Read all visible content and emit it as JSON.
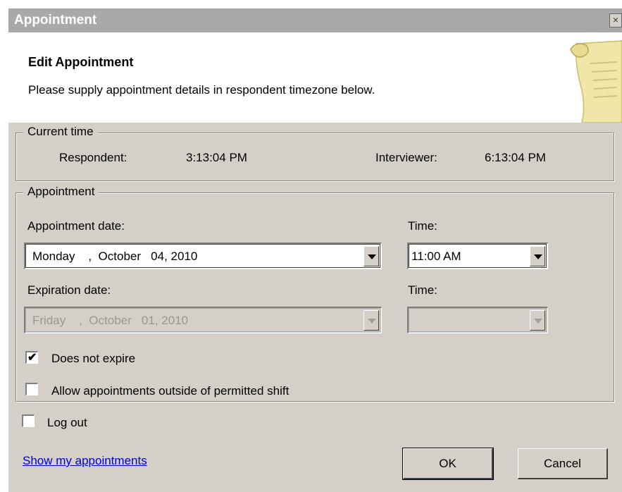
{
  "window": {
    "title": "Appointment",
    "close_glyph": "×"
  },
  "header": {
    "heading": "Edit Appointment",
    "subtitle": "Please supply appointment details in respondent timezone below.",
    "icon": "scroll-icon"
  },
  "current_time": {
    "legend": "Current time",
    "respondent_label": "Respondent:",
    "respondent_value": "3:13:04 PM",
    "interviewer_label": "Interviewer:",
    "interviewer_value": "6:13:04 PM"
  },
  "appointment": {
    "legend": "Appointment",
    "date_label": "Appointment date:",
    "date_value": "Monday    ,  October   04, 2010",
    "time_label": "Time:",
    "time_value": "11:00 AM",
    "expiration_label": "Expiration date:",
    "expiration_value": "Friday    ,  October   01, 2010",
    "expiration_time_label": "Time:",
    "expiration_time_value": "",
    "does_not_expire_label": "Does not expire",
    "does_not_expire_checked": true,
    "allow_outside_label": "Allow appointments outside of permitted shift",
    "allow_outside_checked": false
  },
  "logout": {
    "label": "Log out",
    "checked": false
  },
  "footer": {
    "show_link": "Show my appointments",
    "ok_label": "OK",
    "cancel_label": "Cancel"
  },
  "check_glyph": "✔"
}
